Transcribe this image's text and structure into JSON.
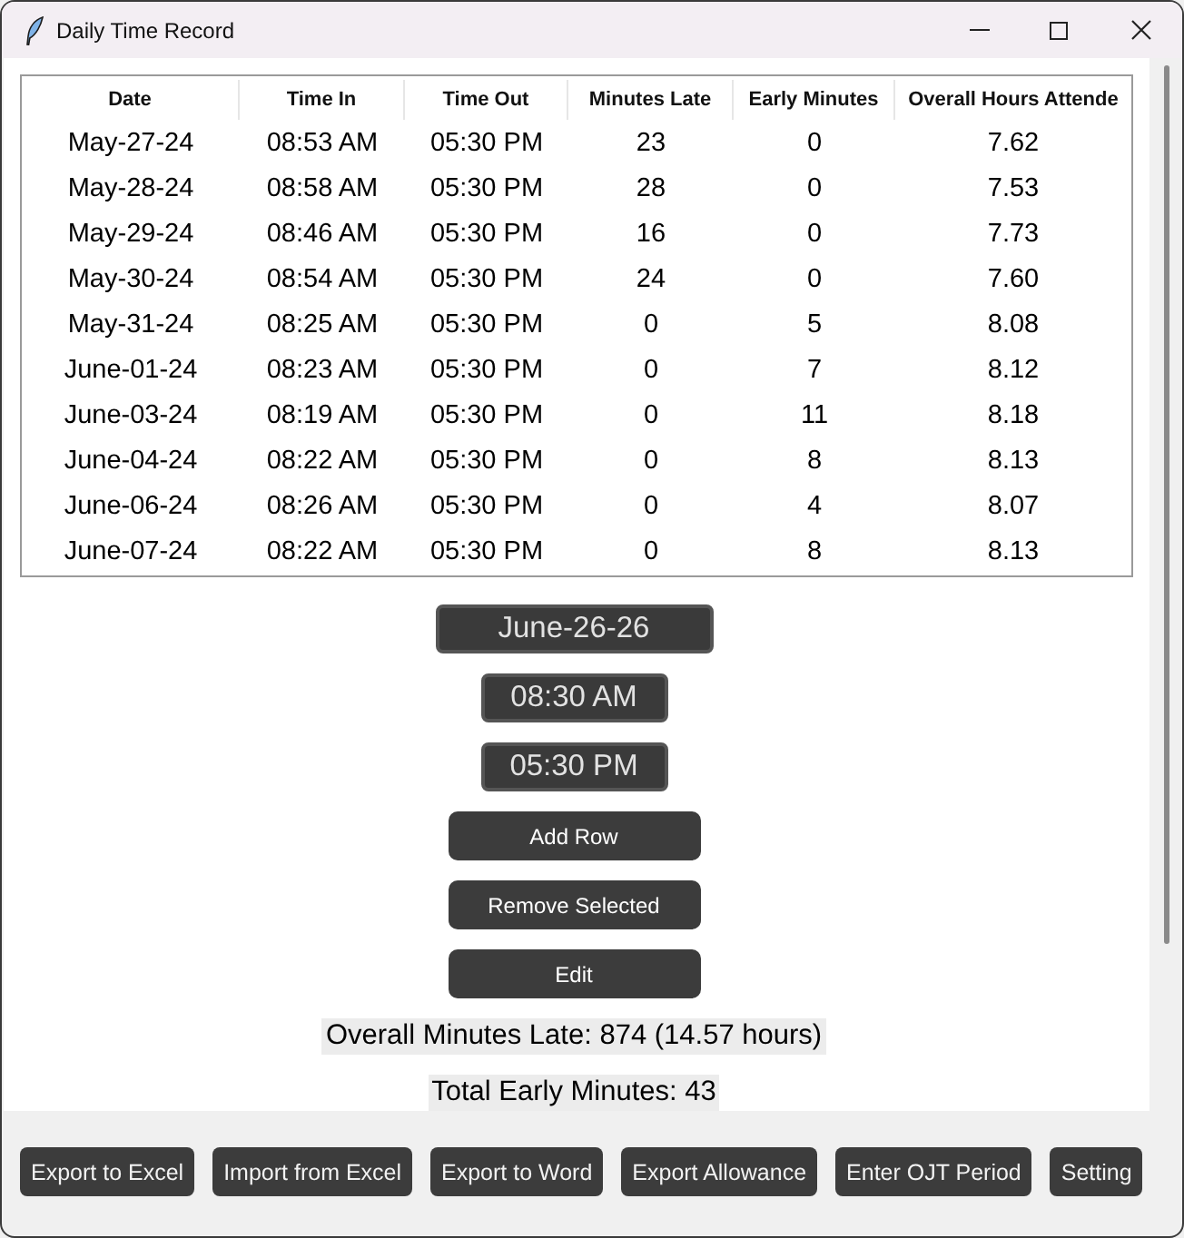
{
  "window": {
    "title": "Daily Time Record"
  },
  "table": {
    "columns": [
      "Date",
      "Time In",
      "Time Out",
      "Minutes Late",
      "Early Minutes",
      "Overall Hours Attende"
    ],
    "rows": [
      [
        "May-27-24",
        "08:53 AM",
        "05:30 PM",
        "23",
        "0",
        "7.62"
      ],
      [
        "May-28-24",
        "08:58 AM",
        "05:30 PM",
        "28",
        "0",
        "7.53"
      ],
      [
        "May-29-24",
        "08:46 AM",
        "05:30 PM",
        "16",
        "0",
        "7.73"
      ],
      [
        "May-30-24",
        "08:54 AM",
        "05:30 PM",
        "24",
        "0",
        "7.60"
      ],
      [
        "May-31-24",
        "08:25 AM",
        "05:30 PM",
        "0",
        "5",
        "8.08"
      ],
      [
        "June-01-24",
        "08:23 AM",
        "05:30 PM",
        "0",
        "7",
        "8.12"
      ],
      [
        "June-03-24",
        "08:19 AM",
        "05:30 PM",
        "0",
        "11",
        "8.18"
      ],
      [
        "June-04-24",
        "08:22 AM",
        "05:30 PM",
        "0",
        "8",
        "8.13"
      ],
      [
        "June-06-24",
        "08:26 AM",
        "05:30 PM",
        "0",
        "4",
        "8.07"
      ],
      [
        "June-07-24",
        "08:22 AM",
        "05:30 PM",
        "0",
        "8",
        "8.13"
      ]
    ]
  },
  "fields": [
    {
      "kind": "date",
      "value": "June-26-26"
    },
    {
      "kind": "time",
      "value": "08:30 AM"
    },
    {
      "kind": "time",
      "value": "05:30 PM"
    }
  ],
  "buttons": [
    "Add Row",
    "Remove Selected",
    "Edit"
  ],
  "summary": [
    "Overall Minutes Late: 874 (14.57 hours)",
    "Total Early Minutes: 43"
  ],
  "toolbar": [
    "Export to Excel",
    "Import from Excel",
    "Export to Word",
    "Export Allowance",
    "Enter OJT Period",
    "Setting"
  ]
}
